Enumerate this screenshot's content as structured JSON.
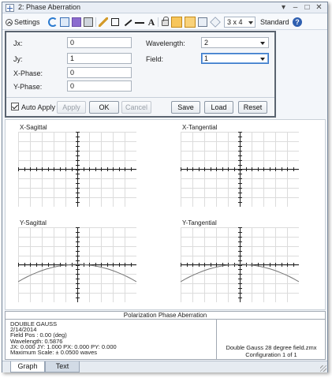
{
  "window": {
    "title": "2: Phase Aberration",
    "controls": [
      "▾",
      "–",
      "□",
      "✕"
    ]
  },
  "toolbar": {
    "settings_label": "Settings",
    "layout_value": "3 x 4",
    "standard_label": "Standard",
    "icons": [
      "refresh-icon",
      "copy-icon",
      "save-icon",
      "print-icon",
      "pencil-icon",
      "rectangle-icon",
      "arrow-icon",
      "line-icon",
      "text-icon",
      "lock-icon",
      "active-icon",
      "active-icon",
      "window-icon",
      "layers-icon",
      "help-icon"
    ]
  },
  "settings": {
    "jx_label": "Jx:",
    "jx_value": "0",
    "jy_label": "Jy:",
    "jy_value": "1",
    "xphase_label": "X-Phase:",
    "xphase_value": "0",
    "yphase_label": "Y-Phase:",
    "yphase_value": "0",
    "wavelength_label": "Wavelength:",
    "wavelength_value": "2",
    "field_label": "Field:",
    "field_value": "1",
    "auto_apply_label": "Auto Apply",
    "auto_apply_checked": true,
    "apply_label": "Apply",
    "ok_label": "OK",
    "cancel_label": "Cancel",
    "save_label": "Save",
    "load_label": "Load",
    "reset_label": "Reset"
  },
  "plots": {
    "x_sagittal": "X-Sagittal",
    "x_tangential": "X-Tangential",
    "y_sagittal": "Y-Sagittal",
    "y_tangential": "Y-Tangential"
  },
  "footer": {
    "title": "Polarization Phase Aberration",
    "lines": [
      "DOUBLE GAUSS",
      "2/14/2014",
      "Field Pos : 0.00 (deg)",
      "Wavelength: 0.5876",
      "JX: 0.000 JY: 1.000 PX: 0.000 PY: 0.000",
      "Maximum Scale: ± 0.0500 waves"
    ],
    "file": "Double Gauss 28 degree field.zmx",
    "config": "Configuration 1 of 1"
  },
  "tabs": [
    "Graph",
    "Text"
  ],
  "colors": {
    "accent": "#f7c65c",
    "help": "#2f5fb0",
    "curve": "#777777"
  }
}
